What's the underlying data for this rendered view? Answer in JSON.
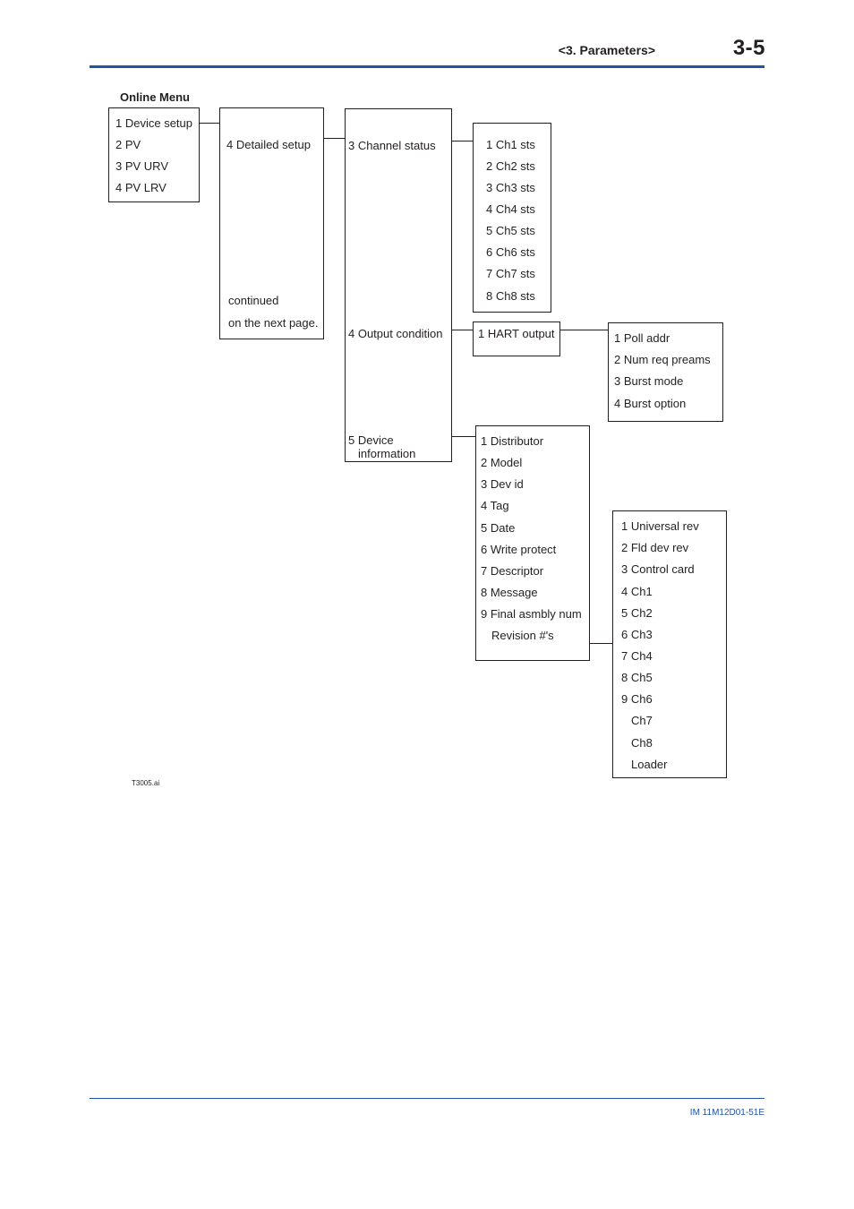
{
  "header": {
    "section": "<3. Parameters>",
    "page_number": "3-5",
    "accent_color": "#2253a5"
  },
  "diagram": {
    "title": "Online Menu",
    "online_menu": [
      "1 Device setup",
      "2 PV",
      "3 PV URV",
      "4 PV LRV"
    ],
    "device_setup": {
      "item": "4 Detailed setup",
      "note_line1": "continued",
      "note_line2": "on the next page."
    },
    "detailed_setup": {
      "channel_status": "3 Channel status",
      "output_condition": "4 Output condition",
      "device_information_line1": "5 Device",
      "device_information_line2": "information"
    },
    "channel_status_items": [
      "1 Ch1 sts",
      "2 Ch2 sts",
      "3 Ch3 sts",
      "4 Ch4 sts",
      "5 Ch5 sts",
      "6 Ch6 sts",
      "7 Ch7 sts",
      "8 Ch8 sts"
    ],
    "output_condition_items": [
      "1 HART output"
    ],
    "hart_output_items": [
      "1 Poll addr",
      "2 Num req preams",
      "3 Burst mode",
      "4 Burst option"
    ],
    "device_information_items": [
      "1 Distributor",
      "2 Model",
      "3 Dev id",
      "4 Tag",
      "5 Date",
      "6 Write protect",
      "7 Descriptor",
      "8 Message",
      "9 Final asmbly num",
      "Revision #'s"
    ],
    "revision_items": [
      "1 Universal rev",
      "2 Fld dev rev",
      "3 Control card",
      "4 Ch1",
      "5 Ch2",
      "6 Ch3",
      "7 Ch4",
      "8 Ch5",
      "9 Ch6",
      "Ch7",
      "Ch8",
      "Loader"
    ],
    "figure_id": "T3005.ai"
  },
  "footer": {
    "doc_number": "IM 11M12D01-51E"
  }
}
